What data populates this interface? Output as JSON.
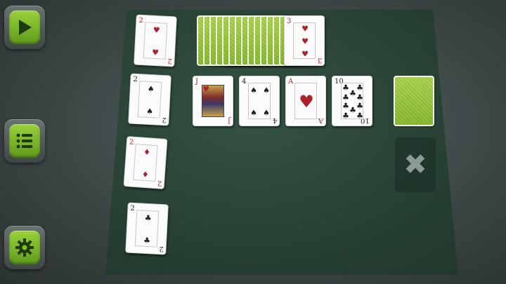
{
  "sidebar": {
    "play_icon": "play-icon",
    "menu_icon": "list-icon",
    "settings_icon": "gear-icon"
  },
  "stock_pile": {
    "count": 14,
    "top_card": {
      "rank": "3",
      "suit": "♥",
      "color": "red"
    }
  },
  "left_column": [
    {
      "rank": "2",
      "suit": "♥",
      "color": "red"
    },
    {
      "rank": "2",
      "suit": "♠",
      "color": "black"
    },
    {
      "rank": "2",
      "suit": "♦",
      "color": "red"
    },
    {
      "rank": "2",
      "suit": "♣",
      "color": "black"
    }
  ],
  "row_cards": [
    {
      "rank": "J",
      "suit": "♥",
      "color": "red",
      "face": true
    },
    {
      "rank": "4",
      "suit": "♠",
      "color": "black"
    },
    {
      "rank": "A",
      "suit": "♥",
      "color": "red"
    },
    {
      "rank": "10",
      "suit": "♣",
      "color": "black"
    }
  ],
  "discard": {
    "icon": "close-icon",
    "symbol": "✖"
  },
  "colors": {
    "felt": "#2a4536",
    "card_back": "#9cc83e",
    "button": "#7cc02a"
  }
}
